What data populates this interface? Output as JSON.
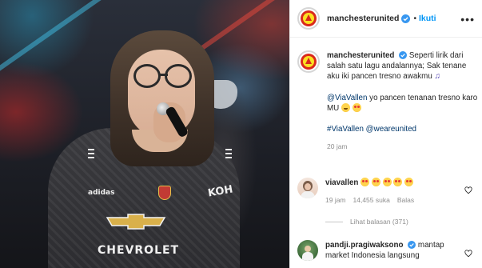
{
  "header": {
    "username": "manchesterunited",
    "follow_label": "Ikuti",
    "separator": "•"
  },
  "caption": {
    "username": "manchesterunited",
    "line1": "Seperti lirik dari salah satu lagu andalannya; Sak tenane aku iki pancen tresno awakmu",
    "mention": "@ViaVallen",
    "line2": "yo pancen tenanan tresno karo MU",
    "hashtag1": "#ViaVallen",
    "hashtag2": "@weareunited",
    "time": "20 jam"
  },
  "comment1": {
    "username": "viavallen",
    "time": "19 jam",
    "likes": "14,455 suka",
    "reply_label": "Balas",
    "view_replies": "Lihat balasan (371)"
  },
  "comment2": {
    "username": "pandji.pragiwaksono",
    "text": "mantap market Indonesia langsung"
  },
  "photo": {
    "shirt_brand": "adidas",
    "shirt_sponsor": "CHEVROLET",
    "shirt_side": "KOH"
  },
  "icons": {
    "verified": "verified-badge-icon",
    "more": "more-options-icon",
    "heart": "heart-outline-icon"
  },
  "colors": {
    "link_blue": "#0095f6",
    "mention_blue": "#00376b",
    "muted": "#8e8e8e"
  }
}
